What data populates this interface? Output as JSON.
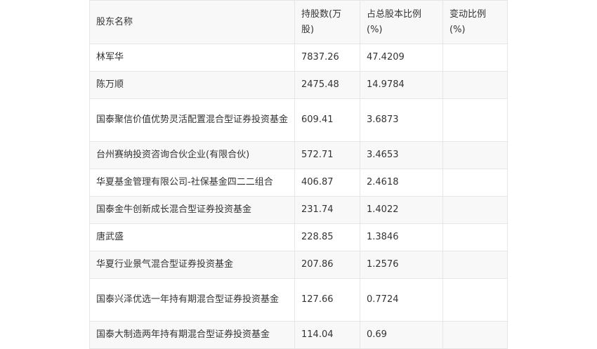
{
  "table": {
    "headers": [
      "股东名称",
      "持股数(万股)",
      "占总股本比例(%)",
      "变动比例(%)"
    ],
    "rows": [
      {
        "name": "林军华",
        "shares": "7837.26",
        "ratio": "47.4209",
        "change": ""
      },
      {
        "name": "陈万顺",
        "shares": "2475.48",
        "ratio": "14.9784",
        "change": ""
      },
      {
        "name": "国泰聚信价值优势灵活配置混合型证券投资基金",
        "shares": "609.41",
        "ratio": "3.6873",
        "change": ""
      },
      {
        "name": "台州赛纳投资咨询合伙企业(有限合伙)",
        "shares": "572.71",
        "ratio": "3.4653",
        "change": ""
      },
      {
        "name": "华夏基金管理有限公司-社保基金四二二组合",
        "shares": "406.87",
        "ratio": "2.4618",
        "change": ""
      },
      {
        "name": "国泰金牛创新成长混合型证券投资基金",
        "shares": "231.74",
        "ratio": "1.4022",
        "change": ""
      },
      {
        "name": "唐武盛",
        "shares": "228.85",
        "ratio": "1.3846",
        "change": ""
      },
      {
        "name": "华夏行业景气混合型证券投资基金",
        "shares": "207.86",
        "ratio": "1.2576",
        "change": ""
      },
      {
        "name": "国泰兴泽优选一年持有期混合型证券投资基金",
        "shares": "127.66",
        "ratio": "0.7724",
        "change": ""
      },
      {
        "name": "国泰大制造两年持有期混合型证券投资基金",
        "shares": "114.04",
        "ratio": "0.69",
        "change": ""
      }
    ]
  }
}
